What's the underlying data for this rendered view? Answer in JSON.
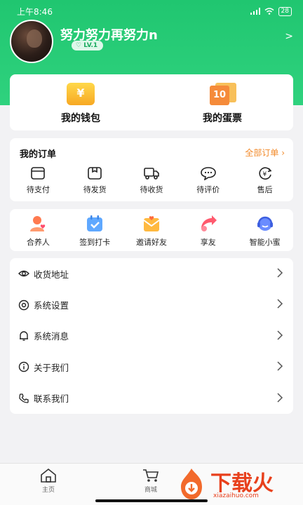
{
  "status_bar": {
    "time": "上午8:46",
    "signal": "ᵢ᷊ᵢ",
    "battery": "28"
  },
  "profile": {
    "username": "努力努力再努力n",
    "level": "LV.1"
  },
  "assets": [
    {
      "label": "我的钱包",
      "icon": "wallet-icon",
      "glyph": "¥"
    },
    {
      "label": "我的蛋票",
      "icon": "ticket-icon",
      "glyph": "10"
    }
  ],
  "orders": {
    "title": "我的订单",
    "all_label": "全部订单 ›",
    "items": [
      {
        "label": "待支付",
        "icon": "card-icon"
      },
      {
        "label": "待发货",
        "icon": "box-icon"
      },
      {
        "label": "待收货",
        "icon": "truck-icon"
      },
      {
        "label": "待评价",
        "icon": "comment-icon"
      },
      {
        "label": "售后",
        "icon": "refund-icon"
      }
    ]
  },
  "services": [
    {
      "label": "合养人",
      "icon": "partner-icon"
    },
    {
      "label": "签到打卡",
      "icon": "checkin-icon"
    },
    {
      "label": "邀请好友",
      "icon": "invite-icon"
    },
    {
      "label": "享友",
      "icon": "share-icon"
    },
    {
      "label": "智能小蜜",
      "icon": "assistant-icon"
    }
  ],
  "menu": [
    {
      "label": "收货地址",
      "icon": "eye-icon"
    },
    {
      "label": "系统设置",
      "icon": "settings-icon"
    },
    {
      "label": "系统消息",
      "icon": "bell-icon"
    },
    {
      "label": "关于我们",
      "icon": "info-icon"
    },
    {
      "label": "联系我们",
      "icon": "phone-icon"
    }
  ],
  "tabbar": [
    {
      "label": "主页",
      "icon": "home-icon"
    },
    {
      "label": "商城",
      "icon": "cart-icon"
    }
  ],
  "watermark": {
    "brand": "下载火",
    "url": "xiazaihuo.com"
  },
  "colors": {
    "brand_green": "#20c670",
    "accent_orange": "#f28a2a",
    "watermark_red": "#e8401c"
  }
}
